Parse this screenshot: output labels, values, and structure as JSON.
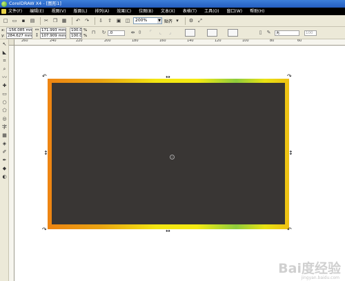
{
  "window": {
    "title": "CorelDRAW X4 - [图形1]"
  },
  "menu": [
    "文件(F)",
    "编辑(E)",
    "视图(V)",
    "版面(L)",
    "排列(A)",
    "效果(C)",
    "位图(B)",
    "文本(X)",
    "表格(T)",
    "工具(O)",
    "窗口(W)",
    "帮助(H)"
  ],
  "toolbar": {
    "zoom": "200%",
    "snap_label": "贴齐"
  },
  "propbar": {
    "x_label": "x:",
    "x_value": "-156.085 mm",
    "y_label": "y:",
    "y_value": "284.627 mm",
    "w_value": "171.993 mm",
    "h_value": "107.909 mm",
    "scale_w": "100.0",
    "scale_h": "100.0",
    "pct": "%",
    "rotation": ".0",
    "fill_label": "无",
    "outline_width": "100"
  },
  "ruler": {
    "h_ticks": [
      "260",
      "240",
      "220",
      "200",
      "180",
      "160",
      "140",
      "120",
      "100",
      "80",
      "60"
    ]
  },
  "watermark": {
    "text": "Bai度经验",
    "sub": "jingyan.baidu.com"
  },
  "colors": {
    "fill": "#393634",
    "outline_start": "#ee8412",
    "outline_mid": "#f3e612",
    "outline_green": "#8fcc3c"
  }
}
